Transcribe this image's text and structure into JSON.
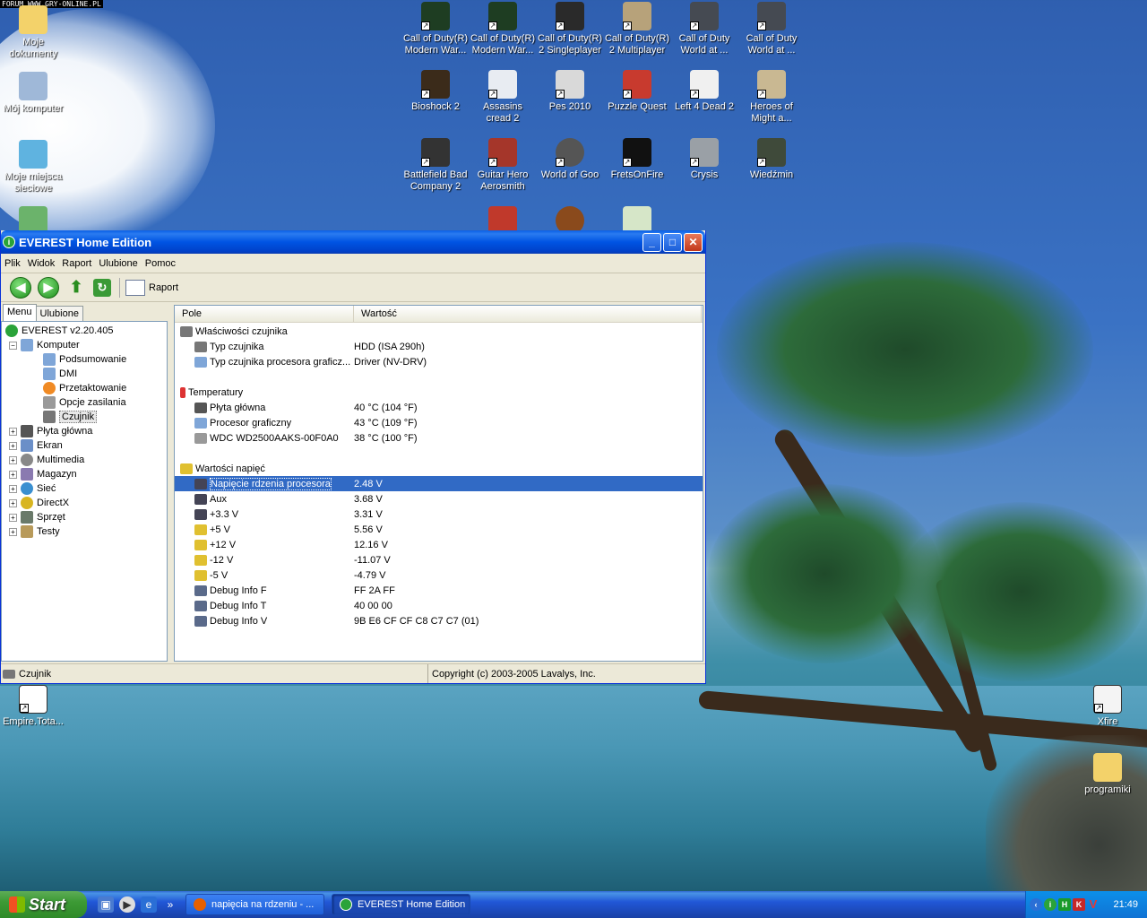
{
  "forum_caption": "FORUM WWW.GRY-ONLINE.PL",
  "desktop": {
    "left_icons": [
      {
        "label": "Moje dokumenty",
        "icon": "folder-icon"
      },
      {
        "label": "Mój komputer",
        "icon": "computer-icon"
      },
      {
        "label": "Moje miejsca sieciowe",
        "icon": "network-places-icon"
      },
      {
        "label": "Empire.Tota...",
        "icon": "file-icon"
      }
    ],
    "game_icons_row1": [
      "Call of Duty(R) Modern War...",
      "Call of Duty(R) Modern War...",
      "Call of Duty(R) 2 Singleplayer",
      "Call of Duty(R) 2 Multiplayer",
      "Call of Duty World at ...",
      "Call of Duty World at ..."
    ],
    "game_icons_row2": [
      "Bioshock 2",
      "Assasins cread 2",
      "Pes 2010",
      "Puzzle Quest",
      "Left 4 Dead 2",
      "Heroes of Might a..."
    ],
    "game_icons_row3": [
      "Battlefield Bad Company 2",
      "Guitar Hero Aerosmith",
      "World of Goo",
      "FretsOnFire",
      "Crysis",
      "Wiedźmin"
    ],
    "right_icons": [
      {
        "label": "Xfire",
        "icon": "xfire-icon"
      },
      {
        "label": "programiki",
        "icon": "folder-icon"
      }
    ]
  },
  "window": {
    "title": "EVEREST Home Edition",
    "menu": [
      "Plik",
      "Widok",
      "Raport",
      "Ulubione",
      "Pomoc"
    ],
    "toolbar": {
      "report_label": "Raport"
    },
    "tabs": [
      "Menu",
      "Ulubione"
    ],
    "tree": {
      "root": "EVEREST v2.20.405",
      "computer": "Komputer",
      "computer_children": [
        "Podsumowanie",
        "DMI",
        "Przetaktowanie",
        "Opcje zasilania",
        "Czujnik"
      ],
      "others": [
        "Płyta główna",
        "Ekran",
        "Multimedia",
        "Magazyn",
        "Sieć",
        "DirectX",
        "Sprzęt",
        "Testy"
      ]
    },
    "columns": {
      "field": "Pole",
      "value": "Wartość"
    },
    "groups": [
      {
        "title": "Właściwości czujnika",
        "rows": [
          {
            "field": "Typ czujnika",
            "value": "HDD  (ISA 290h)"
          },
          {
            "field": "Typ czujnika procesora graficz...",
            "value": "Driver  (NV-DRV)"
          }
        ]
      },
      {
        "title": "Temperatury",
        "rows": [
          {
            "field": "Płyta główna",
            "value": "40 °C  (104 °F)"
          },
          {
            "field": "Procesor graficzny",
            "value": "43 °C  (109 °F)"
          },
          {
            "field": "WDC WD2500AAKS-00F0A0",
            "value": "38 °C  (100 °F)"
          }
        ]
      },
      {
        "title": "Wartości napięć",
        "rows": [
          {
            "field": "Napięcie rdzenia procesora",
            "value": "2.48 V"
          },
          {
            "field": "Aux",
            "value": "3.68 V"
          },
          {
            "field": "+3.3 V",
            "value": "3.31 V"
          },
          {
            "field": "+5 V",
            "value": "5.56 V"
          },
          {
            "field": "+12 V",
            "value": "12.16 V"
          },
          {
            "field": "-12 V",
            "value": "-11.07 V"
          },
          {
            "field": "-5 V",
            "value": "-4.79 V"
          },
          {
            "field": "Debug Info F",
            "value": "FF 2A FF"
          },
          {
            "field": "Debug Info T",
            "value": "40 00 00"
          },
          {
            "field": "Debug Info V",
            "value": "9B E6 CF CF C8 C7 C7 (01)"
          }
        ]
      }
    ],
    "status": {
      "left": "Czujnik",
      "right": "Copyright (c) 2003-2005 Lavalys, Inc."
    }
  },
  "taskbar": {
    "start": "Start",
    "tasks": [
      "napięcia na rdzeniu - ...",
      "EVEREST Home Edition"
    ],
    "clock": "21:49"
  }
}
